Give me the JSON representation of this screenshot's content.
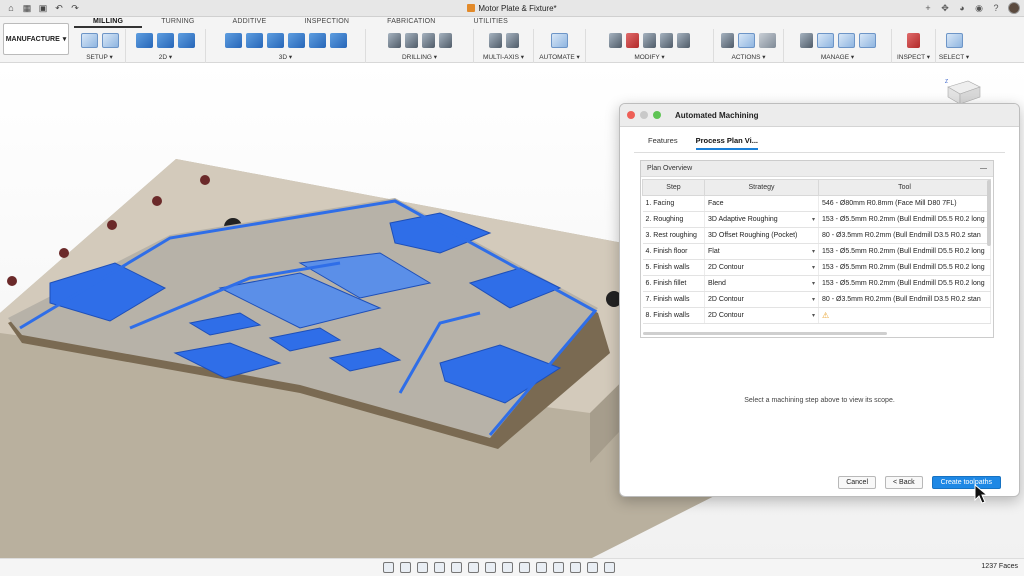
{
  "window": {
    "title": "Motor Plate & Fixture*"
  },
  "ribbon": {
    "workspace": "MANUFACTURE",
    "tabs": [
      "MILLING",
      "TURNING",
      "ADDITIVE",
      "INSPECTION",
      "FABRICATION",
      "UTILITIES"
    ],
    "groups": [
      "SETUP ▾",
      "2D ▾",
      "3D ▾",
      "DRILLING ▾",
      "MULTI-AXIS ▾",
      "AUTOMATE ▾",
      "MODIFY ▾",
      "ACTIONS ▾",
      "MANAGE ▾",
      "INSPECT ▾",
      "SELECT ▾"
    ]
  },
  "dialog": {
    "title": "Automated Machining",
    "tabs": [
      "Features",
      "Process Plan Vi..."
    ],
    "panel_title": "Plan Overview",
    "collapse": "—",
    "columns": [
      "Step",
      "Strategy",
      "Tool"
    ],
    "rows": [
      {
        "step": "1. Facing",
        "strategy": "Face",
        "tool": "546 - Ø80mm R0.8mm (Face Mill D80 7FL)",
        "dropdown": false
      },
      {
        "step": "2. Roughing",
        "strategy": "3D Adaptive Roughing",
        "tool": "153 - Ø5.5mm R0.2mm (Bull Endmill D5.5 R0.2 long",
        "dropdown": true
      },
      {
        "step": "3. Rest roughing",
        "strategy": "3D Offset Roughing (Pocket)",
        "tool": "80 - Ø3.5mm R0.2mm (Bull Endmill D3.5 R0.2 stan",
        "dropdown": false
      },
      {
        "step": "4. Finish floor",
        "strategy": "Flat",
        "tool": "153 - Ø5.5mm R0.2mm (Bull Endmill D5.5 R0.2 long",
        "dropdown": true
      },
      {
        "step": "5. Finish walls",
        "strategy": "2D Contour",
        "tool": "153 - Ø5.5mm R0.2mm (Bull Endmill D5.5 R0.2 long",
        "dropdown": true
      },
      {
        "step": "6. Finish fillet",
        "strategy": "Blend",
        "tool": "153 - Ø5.5mm R0.2mm (Bull Endmill D5.5 R0.2 long",
        "dropdown": true
      },
      {
        "step": "7. Finish walls",
        "strategy": "2D Contour",
        "tool": "80 - Ø3.5mm R0.2mm (Bull Endmill D3.5 R0.2 stan",
        "dropdown": true
      },
      {
        "step": "8. Finish walls",
        "strategy": "2D Contour",
        "tool": "⚠",
        "dropdown": true
      }
    ],
    "scope_message": "Select a machining step above to view its scope.",
    "buttons": {
      "cancel": "Cancel",
      "back": "< Back",
      "create": "Create toolpaths"
    }
  },
  "status": {
    "faces": "1237 Faces"
  },
  "colors": {
    "accent": "#1e88e5",
    "part_blue": "#2f6ee8",
    "stock": "#c9c0ae"
  }
}
